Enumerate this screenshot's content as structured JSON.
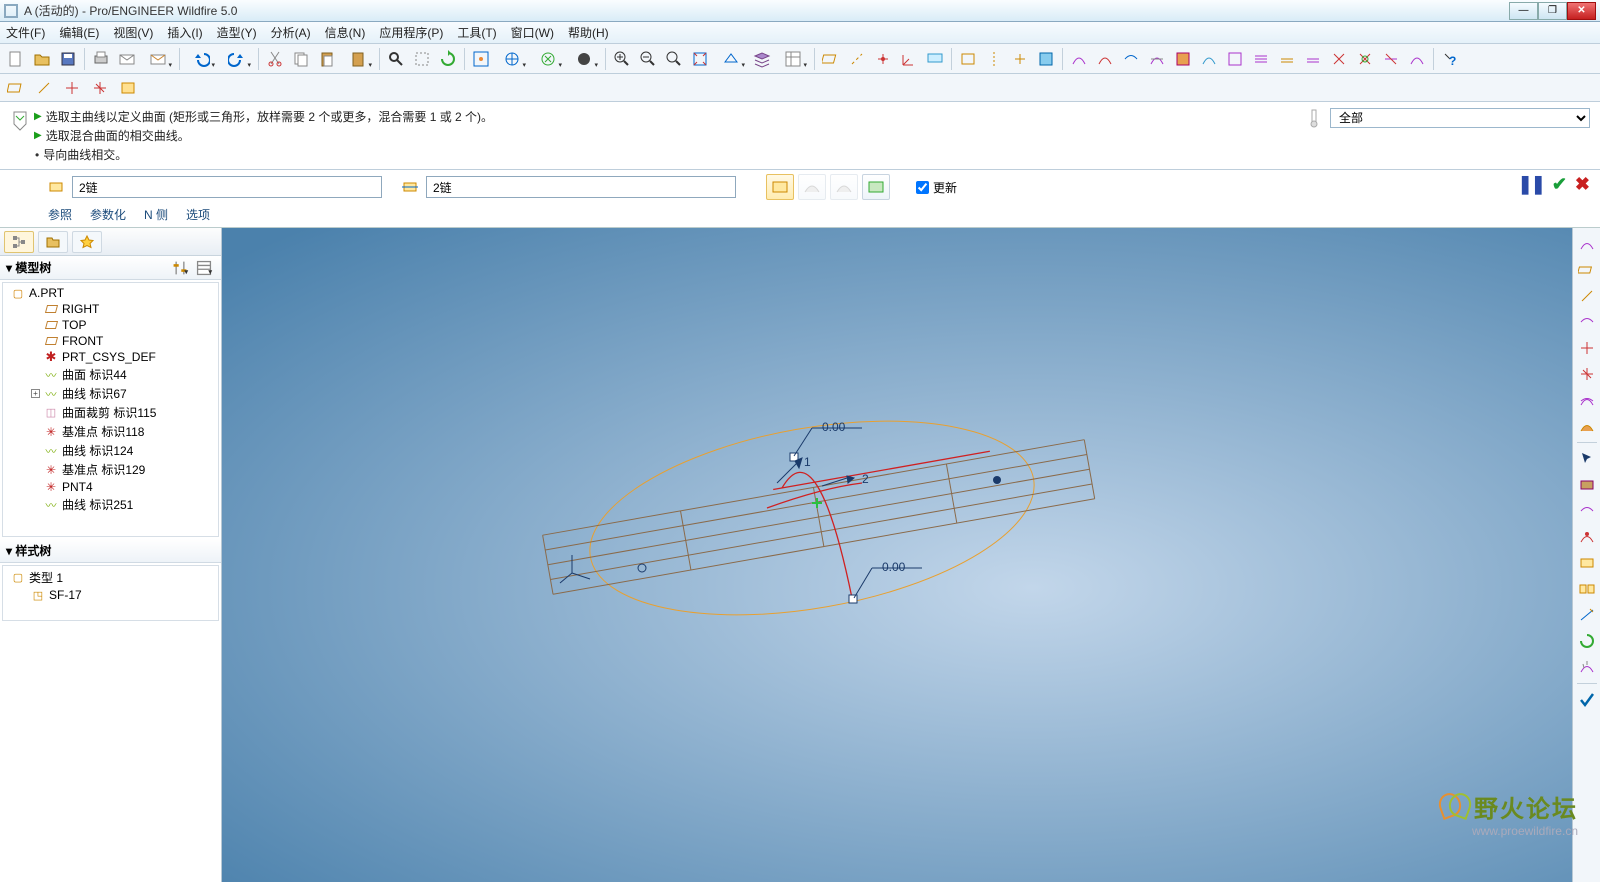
{
  "title": "A (活动的) - Pro/ENGINEER Wildfire 5.0",
  "menu": [
    "文件(F)",
    "编辑(E)",
    "视图(V)",
    "插入(I)",
    "造型(Y)",
    "分析(A)",
    "信息(N)",
    "应用程序(P)",
    "工具(T)",
    "窗口(W)",
    "帮助(H)"
  ],
  "messages": {
    "line1": "选取主曲线以定义曲面 (矩形或三角形，放样需要 2 个或更多，混合需要 1 或 2 个)。",
    "line2": "选取混合曲面的相交曲线。",
    "line3": "导向曲线相交。"
  },
  "filter": {
    "value": "全部"
  },
  "dashboard": {
    "field1": "2链",
    "field2": "2链",
    "update": "更新",
    "tabs": [
      "参照",
      "参数化",
      "N 侧",
      "选项"
    ]
  },
  "dash_controls": {
    "pause": "❚❚",
    "check": "✔",
    "x": "✖"
  },
  "model_tree": {
    "header": "模型树",
    "root": "A.PRT",
    "items": [
      {
        "label": "RIGHT",
        "icon": "plane"
      },
      {
        "label": "TOP",
        "icon": "plane"
      },
      {
        "label": "FRONT",
        "icon": "plane"
      },
      {
        "label": "PRT_CSYS_DEF",
        "icon": "csys"
      },
      {
        "label": "曲面 标识44",
        "icon": "curve"
      },
      {
        "label": "曲线 标识67",
        "icon": "curve",
        "exp": true
      },
      {
        "label": "曲面裁剪 标识115",
        "icon": "surf"
      },
      {
        "label": "基准点 标识118",
        "icon": "pnt"
      },
      {
        "label": "曲线 标识124",
        "icon": "curve"
      },
      {
        "label": "基准点 标识129",
        "icon": "pnt"
      },
      {
        "label": "PNT4",
        "icon": "pnt"
      },
      {
        "label": "曲线 标识251",
        "icon": "curve"
      }
    ]
  },
  "style_tree": {
    "header": "样式树",
    "items": [
      {
        "label": "类型 1",
        "icon": "folder"
      },
      {
        "label": "SF-17",
        "icon": "surf",
        "child": true
      }
    ]
  },
  "canvas": {
    "dim1": "0.00",
    "dim2": "0.00",
    "handle1": "1",
    "handle2": "2"
  },
  "watermark": {
    "big": "野火论坛",
    "url": "www.proewildfire.cn"
  }
}
